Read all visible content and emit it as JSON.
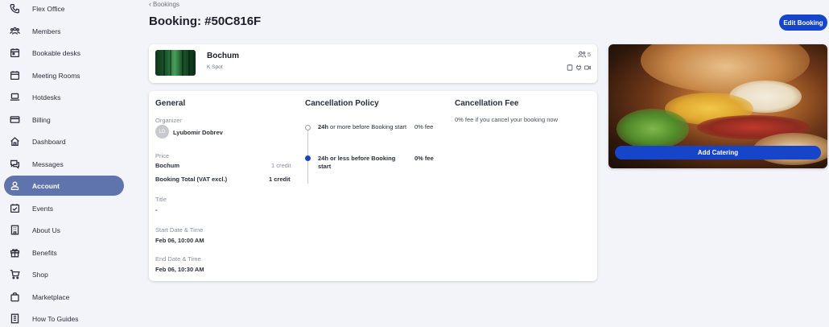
{
  "sidebar": {
    "items": [
      {
        "label": "Flex Office",
        "icon": "phone-icon"
      },
      {
        "label": "Members",
        "icon": "members-icon"
      },
      {
        "label": "Bookable desks",
        "icon": "calendar-icon"
      },
      {
        "label": "Meeting Rooms",
        "icon": "calendar-icon"
      },
      {
        "label": "Hotdesks",
        "icon": "laptop-icon"
      },
      {
        "label": "Billing",
        "icon": "credit-card-icon"
      },
      {
        "label": "Dashboard",
        "icon": "home-icon"
      },
      {
        "label": "Messages",
        "icon": "chat-icon"
      },
      {
        "label": "Account",
        "icon": "user-icon",
        "active": true
      },
      {
        "label": "Events",
        "icon": "event-icon"
      },
      {
        "label": "About Us",
        "icon": "building-icon"
      },
      {
        "label": "Benefits",
        "icon": "gift-icon"
      },
      {
        "label": "Shop",
        "icon": "cart-icon"
      },
      {
        "label": "Marketplace",
        "icon": "bag-icon"
      },
      {
        "label": "How To Guides",
        "icon": "guide-icon"
      }
    ]
  },
  "header": {
    "back_label": "Bookings",
    "title": "Booking: #50C816F",
    "edit_label": "Edit Booking"
  },
  "space": {
    "name": "Bochum",
    "subtitle": "K Spot",
    "capacity": "5"
  },
  "general": {
    "heading": "General",
    "organizer_label": "Organizer",
    "organizer_initials": "LD",
    "organizer_name": "Lyubomir Dobrev",
    "price_label": "Price",
    "price_item": "Bochum",
    "price_item_value": "1 credit",
    "total_label": "Booking Total (VAT excl.)",
    "total_value": "1 credit",
    "title_label": "Title",
    "title_value": "-",
    "start_label": "Start Date & Time",
    "start_value": "Feb 06, 10:00 AM",
    "end_label": "End Date & Time",
    "end_value": "Feb 06, 10:30 AM"
  },
  "cancellation": {
    "heading": "Cancellation Policy",
    "rule1_bold": "24h",
    "rule1_text": " or more before Booking start",
    "rule1_fee": "0% fee",
    "rule2_line1": "24h or less before Booking",
    "rule2_line2": "start",
    "rule2_fee": "0% fee"
  },
  "fee": {
    "heading": "Cancellation Fee",
    "text": "0% fee if you cancel your booking now"
  },
  "catering": {
    "button_label": "Add Catering"
  },
  "colors": {
    "accent": "#1745c9",
    "sidebar_active": "#5f74ad"
  }
}
